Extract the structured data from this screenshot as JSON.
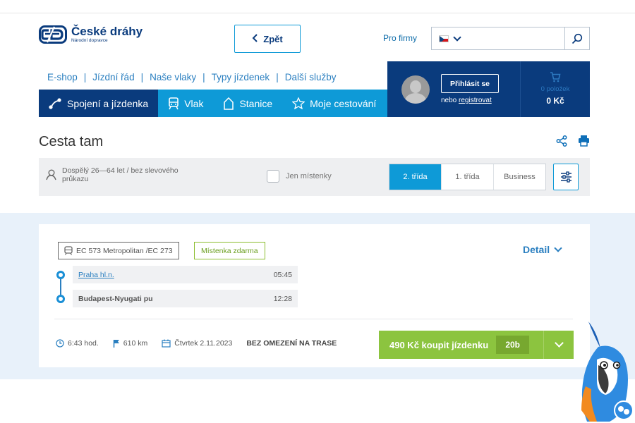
{
  "brand": {
    "name": "České dráhy",
    "tagline": "Národní dopravce"
  },
  "header": {
    "back_label": "Zpět",
    "pro_firmy": "Pro firmy",
    "search": {
      "value": "",
      "placeholder": ""
    },
    "language_flag": "cz-flag-icon"
  },
  "toplinks": [
    "E-shop",
    "Jízdní řád",
    "Naše vlaky",
    "Typy jízdenek",
    "Další služby"
  ],
  "nav": [
    {
      "label": "Spojení a jízdenka",
      "icon": "route-icon",
      "active": true
    },
    {
      "label": "Vlak",
      "icon": "train-icon",
      "active": false
    },
    {
      "label": "Stanice",
      "icon": "station-icon",
      "active": false
    },
    {
      "label": "Moje cestování",
      "icon": "star-icon",
      "active": false
    }
  ],
  "account": {
    "login_label": "Přihlásit se",
    "register_prefix": "nebo",
    "register_link": "registrovat"
  },
  "cart": {
    "items": "0 položek",
    "total": "0 Kč"
  },
  "page": {
    "title": "Cesta tam"
  },
  "filters": {
    "passenger": "Dospělý 26—64 let / bez slevového průkazu",
    "seat_only": "Jen místenky",
    "classes": [
      {
        "label": "2. třída",
        "active": true
      },
      {
        "label": "1. třída",
        "active": false
      },
      {
        "label": "Business",
        "active": false
      }
    ]
  },
  "connection": {
    "train": "EC 573 Metropolitan /EC 273",
    "badge": "Místenka zdarma",
    "detail_label": "Detail",
    "stops": [
      {
        "station": "Praha hl.n.",
        "time": "05:45"
      },
      {
        "station": "Budapest-Nyugati pu",
        "time": "12:28"
      }
    ],
    "duration": "6:43 hod.",
    "distance": "610 km",
    "date": "Čtvrtek 2.11.2023",
    "restriction": "BEZ OMEZENÍ NA TRASE",
    "buy_label": "490 Kč koupit jízdenku",
    "points": "20b"
  },
  "colors": {
    "navy": "#0a3b7d",
    "blue": "#0e9ad7",
    "green": "#8cc43f"
  }
}
